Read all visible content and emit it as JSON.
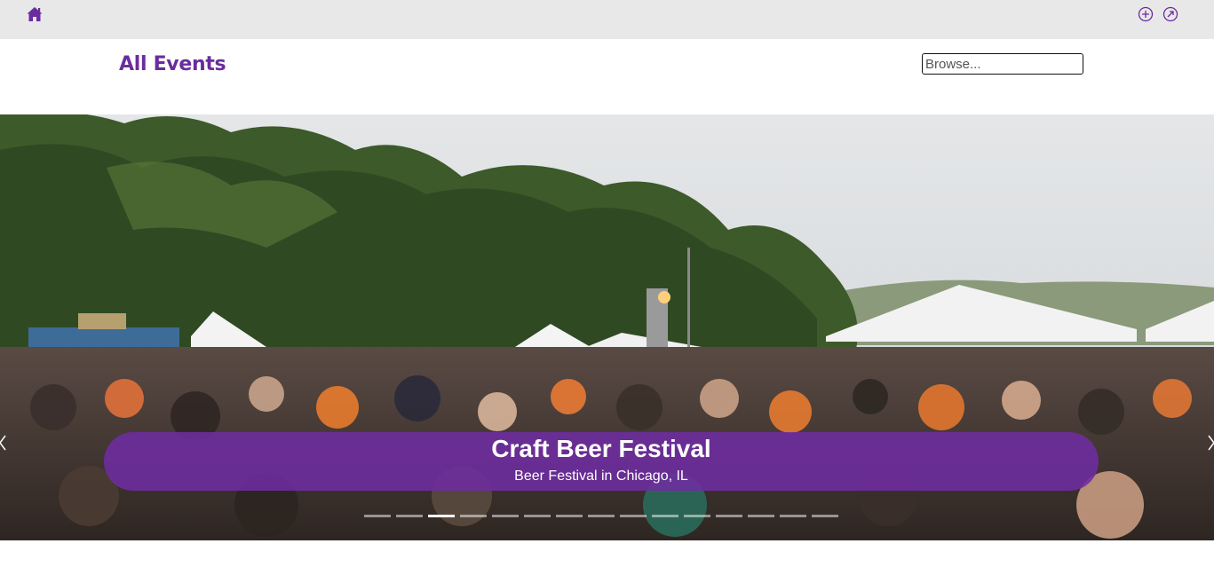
{
  "header": {
    "icons": [
      "home-icon",
      "add-circle-icon",
      "external-link-circle-icon"
    ],
    "accent_color": "#6a2c9e",
    "bar_color": "#e8e8e8"
  },
  "main": {
    "title": "All Events",
    "search": {
      "placeholder": "Browse...",
      "value": ""
    }
  },
  "carousel": {
    "active_slide": 3,
    "slide_count": 15,
    "slide": {
      "title": "Craft Beer Festival",
      "subtitle": "Beer Festival in Chicago, IL",
      "image": "outdoor-festival-crowd-photo"
    },
    "caption_color": "#6e2ca0",
    "prev_icon": "chevron-left-icon",
    "next_icon": "chevron-right-icon"
  }
}
